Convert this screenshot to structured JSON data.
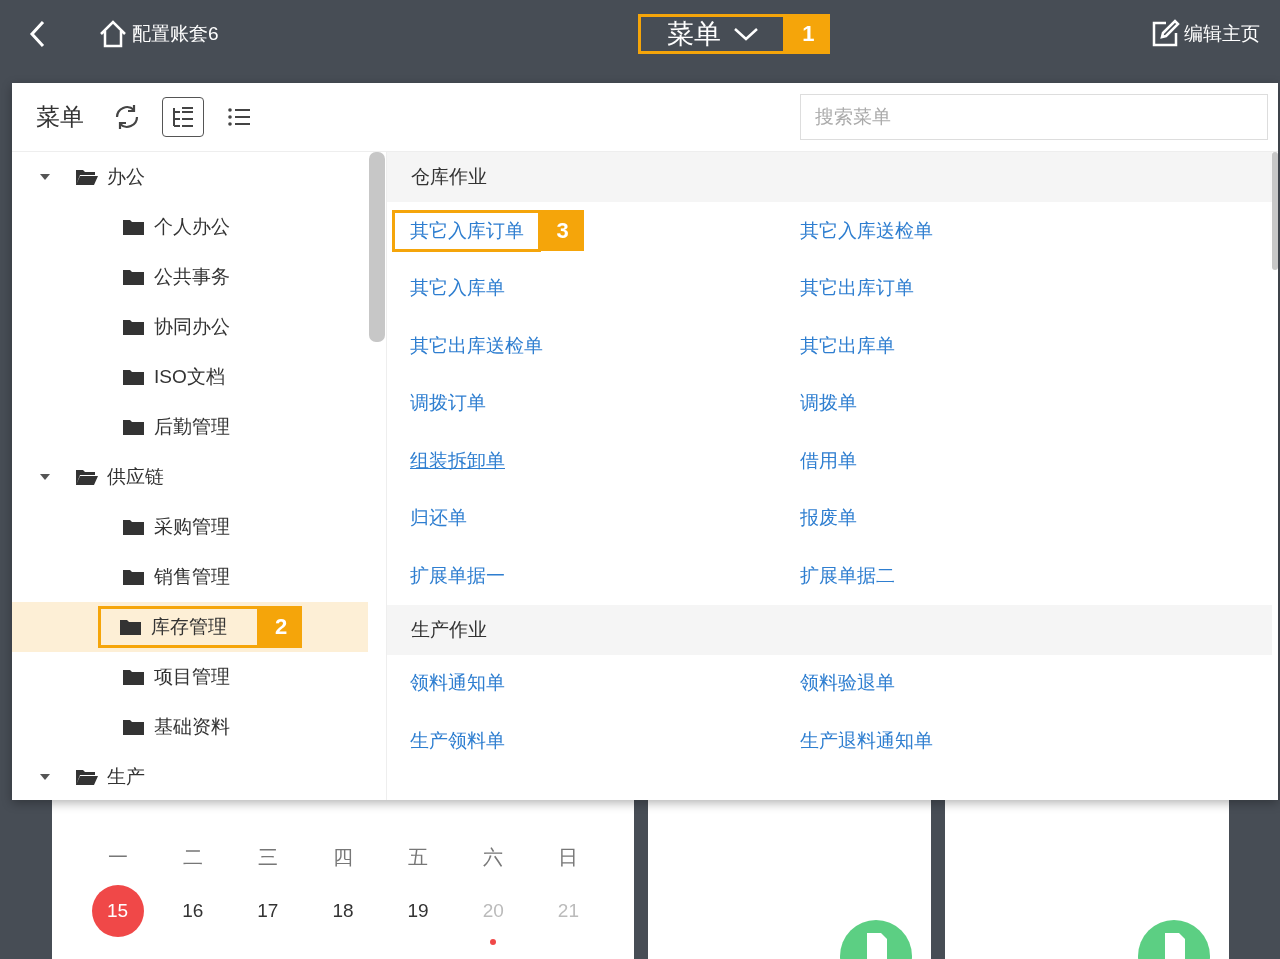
{
  "top_bar": {
    "home_label": "配置账套6",
    "title": "菜单",
    "title_callout": "1",
    "edit_label": "编辑主页"
  },
  "menu_panel": {
    "title": "菜单",
    "views": [
      {
        "kind": "tree",
        "selected": true
      },
      {
        "kind": "list",
        "selected": false
      }
    ],
    "search": {
      "placeholder": "搜索菜单"
    },
    "tree": [
      {
        "label": "办公",
        "expanded": true,
        "selected": false,
        "children": [
          {
            "label": "个人办公",
            "selected": false
          },
          {
            "label": "公共事务",
            "selected": false
          },
          {
            "label": "协同办公",
            "selected": false
          },
          {
            "label": "ISO文档",
            "selected": false
          },
          {
            "label": "后勤管理",
            "selected": false
          }
        ]
      },
      {
        "label": "供应链",
        "expanded": true,
        "selected": false,
        "children": [
          {
            "label": "采购管理",
            "selected": false
          },
          {
            "label": "销售管理",
            "selected": false
          },
          {
            "label": "库存管理",
            "selected": true,
            "callout": "2"
          },
          {
            "label": "项目管理",
            "selected": false
          },
          {
            "label": "基础资料",
            "selected": false
          }
        ]
      },
      {
        "label": "生产",
        "expanded": true,
        "selected": false
      }
    ],
    "sections": [
      {
        "title": "仓库作业",
        "links": [
          {
            "label": "其它入库订单",
            "hovered": false,
            "callout": "3"
          },
          {
            "label": "其它入库送检单",
            "hovered": false
          },
          {
            "label": "其它入库单",
            "hovered": false
          },
          {
            "label": "其它出库订单",
            "hovered": false
          },
          {
            "label": "其它出库送检单",
            "hovered": false
          },
          {
            "label": "其它出库单",
            "hovered": false
          },
          {
            "label": "调拨订单",
            "hovered": false
          },
          {
            "label": "调拨单",
            "hovered": false
          },
          {
            "label": "组装拆卸单",
            "hovered": true
          },
          {
            "label": "借用单",
            "hovered": false
          },
          {
            "label": "归还单",
            "hovered": false
          },
          {
            "label": "报废单",
            "hovered": false
          },
          {
            "label": "扩展单据一",
            "hovered": false
          },
          {
            "label": "扩展单据二",
            "hovered": false
          }
        ]
      },
      {
        "title": "生产作业",
        "links": [
          {
            "label": "领料通知单",
            "hovered": false
          },
          {
            "label": "领料验退单",
            "hovered": false
          },
          {
            "label": "生产领料单",
            "hovered": false
          },
          {
            "label": "生产退料通知单",
            "hovered": false
          }
        ]
      }
    ]
  },
  "dashboard": {
    "schedule": {
      "weekdays": [
        "一",
        "二",
        "三",
        "四",
        "五",
        "六",
        "日"
      ],
      "days": [
        {
          "label": "15",
          "today": true,
          "weekend": false,
          "has_event": false
        },
        {
          "label": "16",
          "today": false,
          "weekend": false,
          "has_event": false
        },
        {
          "label": "17",
          "today": false,
          "weekend": false,
          "has_event": false
        },
        {
          "label": "18",
          "today": false,
          "weekend": false,
          "has_event": false
        },
        {
          "label": "19",
          "today": false,
          "weekend": false,
          "has_event": false
        },
        {
          "label": "20",
          "today": false,
          "weekend": true,
          "has_event": true
        },
        {
          "label": "21",
          "today": false,
          "weekend": true,
          "has_event": false
        }
      ]
    },
    "approvals": [
      {
        "kind": "approval"
      },
      {
        "kind": "approval"
      }
    ]
  }
}
